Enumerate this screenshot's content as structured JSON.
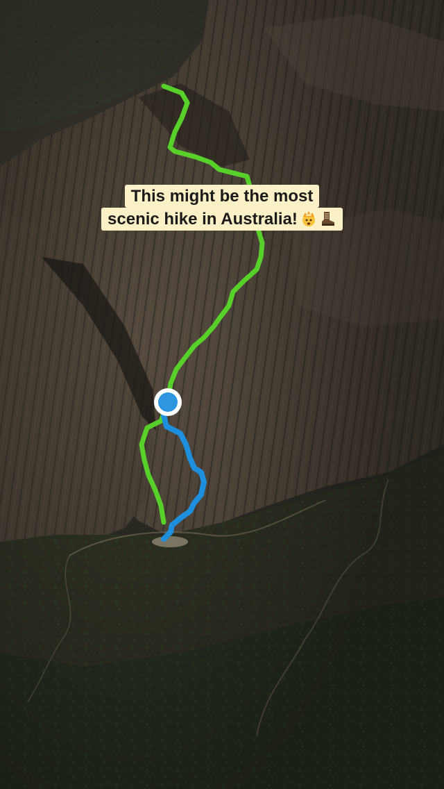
{
  "caption": {
    "line1": "This might be the most",
    "line2": "scenic hike in Australia!",
    "emojis": [
      "exploding-head-emoji",
      "hiking-boot-emoji"
    ]
  },
  "map": {
    "type": "satellite-3d-terrain",
    "routes": [
      {
        "name": "",
        "color": "#57d12a"
      },
      {
        "name": "",
        "color": "#1e8fdc"
      }
    ],
    "position_marker_color": "#2e95e0"
  }
}
